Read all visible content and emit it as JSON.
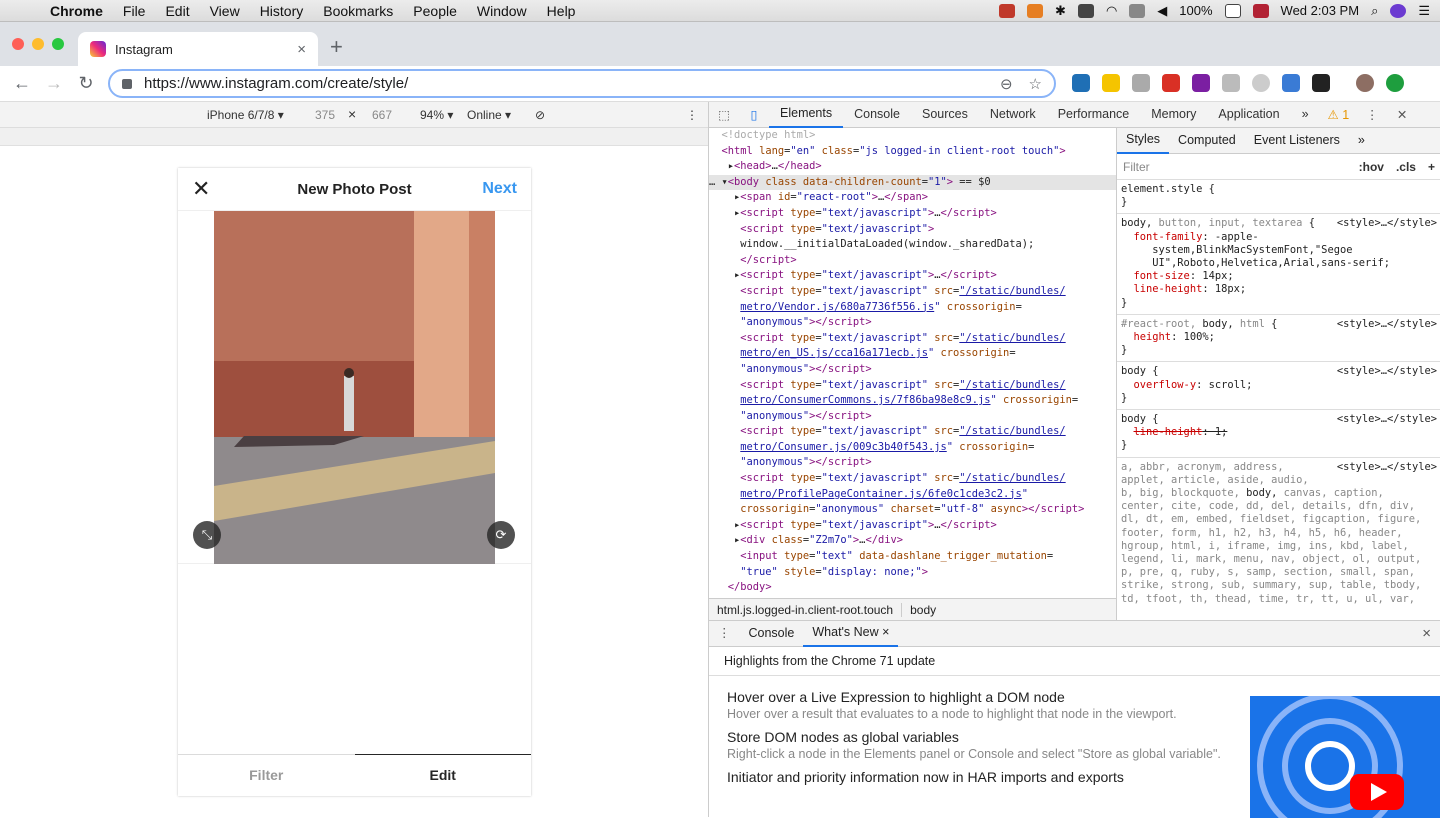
{
  "menubar": {
    "app": "Chrome",
    "items": [
      "File",
      "Edit",
      "View",
      "History",
      "Bookmarks",
      "People",
      "Window",
      "Help"
    ],
    "battery": "100%",
    "datetime": "Wed 2:03 PM"
  },
  "tab": {
    "title": "Instagram",
    "close": "×",
    "new_tab": "+"
  },
  "toolbar": {
    "url": "https://www.instagram.com/create/style/",
    "back": "←",
    "forward": "→",
    "reload": "↻"
  },
  "device": {
    "model": "iPhone 6/7/8 ▾",
    "width": "375",
    "times": "×",
    "height": "667",
    "zoom": "94% ▾",
    "network": "Online ▾",
    "more": "⋮"
  },
  "phone": {
    "close": "✕",
    "title": "New Photo Post",
    "next": "Next",
    "tabs": {
      "filter": "Filter",
      "edit": "Edit"
    }
  },
  "devtools": {
    "tabs": [
      "Elements",
      "Console",
      "Sources",
      "Network",
      "Performance",
      "Memory",
      "Application",
      "»"
    ],
    "warnings": "⚠ 1",
    "breadcrumb": [
      "html.js.logged-in.client-root.touch",
      "body"
    ],
    "styles_tabs": [
      "Styles",
      "Computed",
      "Event Listeners",
      "»"
    ],
    "filter_placeholder": "Filter",
    "hov": ":hov",
    "cls": ".cls",
    "plus": "+",
    "drawer_tabs": [
      "Console",
      "What's New ×"
    ],
    "drawer_close": "×",
    "highlights": "Highlights from the Chrome 71 update",
    "whats_new": [
      {
        "title": "Hover over a Live Expression to highlight a DOM node",
        "desc": "Hover over a result that evaluates to a node to highlight that node in the viewport."
      },
      {
        "title": "Store DOM nodes as global variables",
        "desc": "Right-click a node in the Elements panel or Console and select \"Store as global variable\"."
      },
      {
        "title": "Initiator and priority information now in HAR imports and exports",
        "desc": ""
      }
    ]
  },
  "colors": {
    "accent": "#1a73e8",
    "instagram_blue": "#3897f0"
  }
}
